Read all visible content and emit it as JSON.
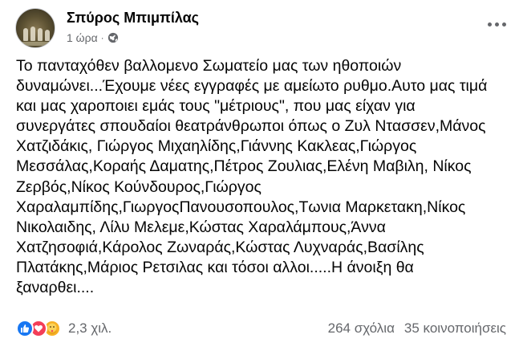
{
  "post": {
    "author": "Σπύρος Μπιμπίλας",
    "time": "1 ώρα",
    "separator": "·",
    "text": "Το πανταχόθεν βαλλομενο Σωματείο μας των ηθοποιών\nδυναμώνει...Έχουμε νέες εγγραφές με αμείωτο ρυθμο.Αυτο μας τιμά\nκαι μας χαροποιει εμάς τους \"μέτριους\", που μας είχαν για\nσυνεργάτες σπουδαίοι θεατράνθρωποι όπως ο Ζυλ Ντασσεν,Μάνος\nΧατζιδάκις, Γιώργος Μιχαηλίδης,Γιάννης Κακλεας,Γιώργος\nΜεσσάλας,Κοραής Δαματης,Πέτρος Ζουλιας,Ελένη Μαβιλη, Νίκος\nΖερβός,Νίκος Κούνδουρος,Γιώργος\nΧαραλαμπίδης,ΓιωργοςΠανουσοπουλος,Τωνια Μαρκετακη,Νίκος\nΝικολαιδης, Λίλυ Μελεμε,Κώστας Χαραλάμπους,Άννα\nΧατζησοφιά,Κάρολος Ζωναράς,Κώστας Λυχναράς,Βασίλης\nΠλατάκης,Μάριος Ρετσιλας και τόσοι αλλοι.....Η άνοιξη θα\nξαναρθει...."
  },
  "footer": {
    "reaction_count": "2,3 χιλ.",
    "comments": "264 σχόλια",
    "shares": "35 κοινοποιήσεις"
  },
  "icons": {
    "globe": "globe-icon",
    "more": "more-options-icon",
    "reactions": [
      "like-icon",
      "love-icon",
      "care-icon"
    ]
  },
  "colors": {
    "text": "#050505",
    "secondary": "#65676b",
    "like": "#1877f2",
    "love": "#f33e58",
    "care": "#f7b125"
  }
}
